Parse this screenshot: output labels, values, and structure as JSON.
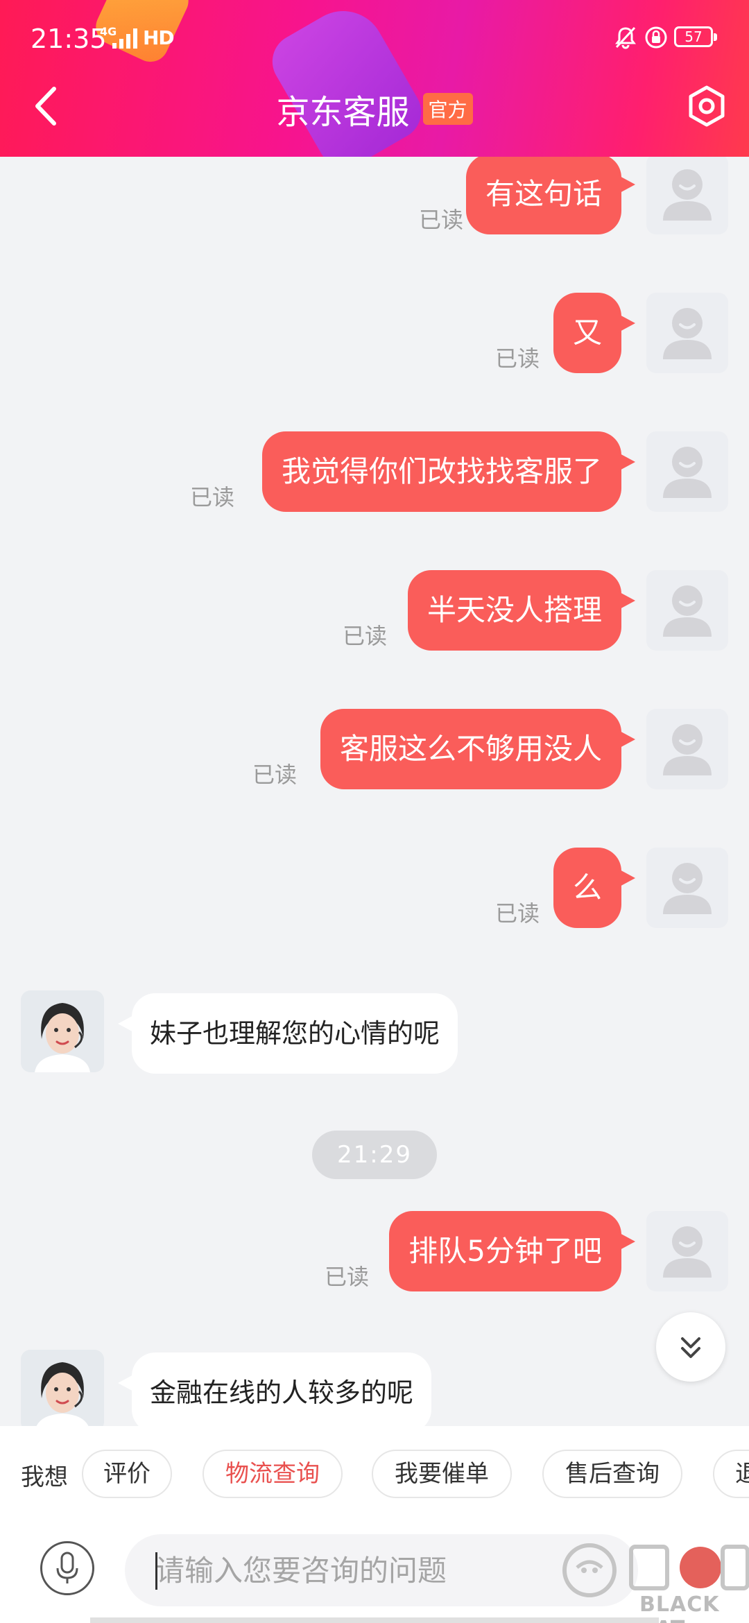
{
  "status_bar": {
    "time": "21:35",
    "network": "4G",
    "hd": "HD",
    "battery": "57"
  },
  "header": {
    "title": "京东客服",
    "badge": "官方"
  },
  "messages": [
    {
      "dir": "out",
      "text": "有这句话",
      "read": "已读"
    },
    {
      "dir": "out",
      "text": "又",
      "read": "已读"
    },
    {
      "dir": "out",
      "text": "我觉得你们改找找客服了",
      "read": "已读"
    },
    {
      "dir": "out",
      "text": "半天没人搭理",
      "read": "已读"
    },
    {
      "dir": "out",
      "text": "客服这么不够用没人",
      "read": "已读"
    },
    {
      "dir": "out",
      "text": "么",
      "read": "已读"
    },
    {
      "dir": "in",
      "text": "妹子也理解您的心情的呢"
    },
    {
      "dir": "time",
      "text": "21:29"
    },
    {
      "dir": "out",
      "text": "排队5分钟了吧",
      "read": "已读"
    },
    {
      "dir": "in",
      "text": "金融在线的人较多的呢"
    }
  ],
  "quick_bar": {
    "label": "我想",
    "chips": [
      "评价",
      "物流查询",
      "我要催单",
      "售后查询",
      "退"
    ]
  },
  "input": {
    "placeholder": "请输入您要咨询的问题"
  },
  "watermark": {
    "text": "BLACK CAT"
  },
  "colors": {
    "accent": "#fa5d5a",
    "header_start": "#ff1a55",
    "header_mid": "#e81aa6"
  }
}
